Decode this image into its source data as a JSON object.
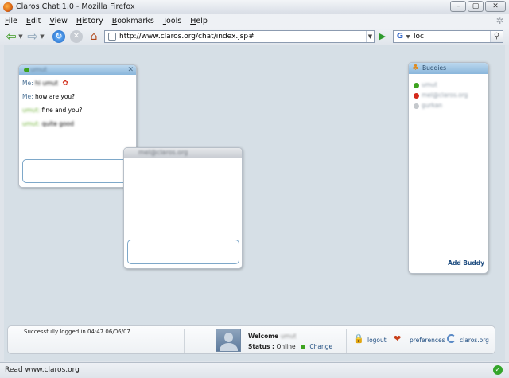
{
  "window": {
    "title": "Claros Chat 1.0 - Mozilla Firefox",
    "minimize": "–",
    "maximize": "▢",
    "close": "✕"
  },
  "menu": [
    "File",
    "Edit",
    "View",
    "History",
    "Bookmarks",
    "Tools",
    "Help"
  ],
  "navbar": {
    "url": "http://www.claros.org/chat/index.jsp#",
    "search_value": "loc",
    "search_engine_icon": "G"
  },
  "chat1": {
    "buddy_name": "umut",
    "messages": [
      {
        "sender": "Me:",
        "text": "hi umut",
        "text_blurred": true,
        "has_flower": true
      },
      {
        "sender": "Me:",
        "text": "how are you?",
        "text_blurred": false
      },
      {
        "sender": "umut:",
        "sender_blurred": true,
        "text": "fine and you?",
        "text_blurred": false
      },
      {
        "sender": "umut:",
        "sender_blurred": true,
        "text": "quite good",
        "text_blurred": true
      }
    ]
  },
  "chat2": {
    "buddy_name": "mel@claros.org"
  },
  "buddies": {
    "title": "Buddies",
    "list": [
      {
        "name": "umut",
        "status_color": "#3da31f"
      },
      {
        "name": "mel@claros.org",
        "status_color": "#d42a1c"
      },
      {
        "name": "gurkan",
        "status_color": "#c4c8cc"
      }
    ],
    "add_label": "Add Buddy"
  },
  "bottom": {
    "status_message": "Successfully logged in 04:47 06/06/07",
    "welcome_label": "Welcome",
    "welcome_user": "umut",
    "status_label": "Status :",
    "status_value": "Online",
    "change_label": "Change",
    "logout_label": "logout",
    "preferences_label": "preferences",
    "claros_label": "claros.org"
  },
  "statusbar": {
    "text": "Read www.claros.org"
  }
}
